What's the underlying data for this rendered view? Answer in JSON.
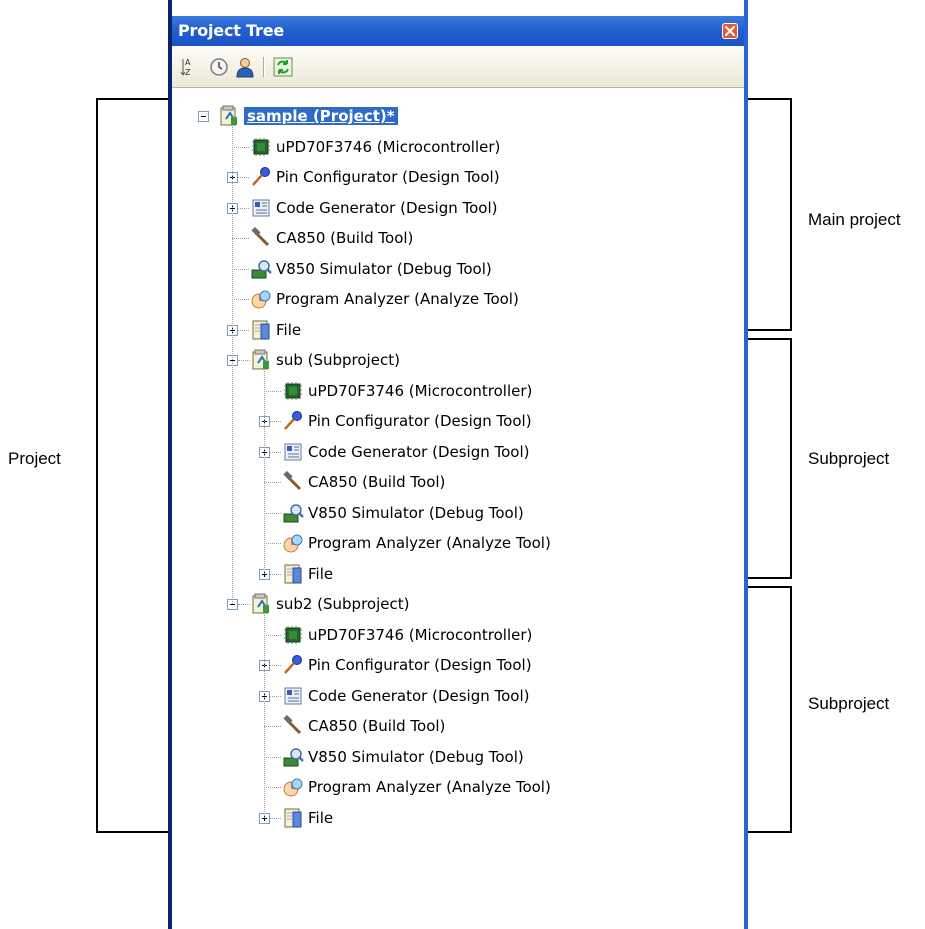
{
  "window": {
    "title": "Project Tree",
    "toolbar": {
      "buttons": [
        {
          "icon": "sort-az-icon"
        },
        {
          "icon": "clock-icon"
        },
        {
          "icon": "user-icon"
        },
        {
          "icon": "refresh-icon"
        }
      ]
    }
  },
  "tree": {
    "root": "sample (Project)*",
    "main_items": [
      {
        "label": "uPD70F3746 (Microcontroller)",
        "icon": "chip-icon"
      },
      {
        "label": "Pin Configurator (Design Tool)",
        "icon": "pin-icon"
      },
      {
        "label": "Code Generator (Design Tool)",
        "icon": "code-generator-icon"
      },
      {
        "label": "CA850 (Build Tool)",
        "icon": "hammer-icon"
      },
      {
        "label": "V850 Simulator (Debug Tool)",
        "icon": "debug-icon"
      },
      {
        "label": "Program Analyzer (Analyze Tool)",
        "icon": "analyzer-icon"
      },
      {
        "label": "File",
        "icon": "file-icon"
      }
    ],
    "subprojects": [
      {
        "label": "sub (Subproject)",
        "items": [
          {
            "label": "uPD70F3746 (Microcontroller)",
            "icon": "chip-icon"
          },
          {
            "label": "Pin Configurator (Design Tool)",
            "icon": "pin-icon"
          },
          {
            "label": "Code Generator (Design Tool)",
            "icon": "code-generator-icon"
          },
          {
            "label": "CA850 (Build Tool)",
            "icon": "hammer-icon"
          },
          {
            "label": "V850 Simulator (Debug Tool)",
            "icon": "debug-icon"
          },
          {
            "label": "Program Analyzer (Analyze Tool)",
            "icon": "analyzer-icon"
          },
          {
            "label": "File",
            "icon": "file-icon"
          }
        ]
      },
      {
        "label": "sub2 (Subproject)",
        "items": [
          {
            "label": "uPD70F3746 (Microcontroller)",
            "icon": "chip-icon"
          },
          {
            "label": "Pin Configurator (Design Tool)",
            "icon": "pin-icon"
          },
          {
            "label": "Code Generator (Design Tool)",
            "icon": "code-generator-icon"
          },
          {
            "label": "CA850 (Build Tool)",
            "icon": "hammer-icon"
          },
          {
            "label": "V850 Simulator (Debug Tool)",
            "icon": "debug-icon"
          },
          {
            "label": "Program Analyzer (Analyze Tool)",
            "icon": "analyzer-icon"
          },
          {
            "label": "File",
            "icon": "file-icon"
          }
        ]
      }
    ]
  },
  "annotations": {
    "project": "Project",
    "main_project": "Main project",
    "subproject_1": "Subproject",
    "subproject_2": "Subproject"
  },
  "colors": {
    "titlebar": "#2460d0",
    "selection": "#316ac5",
    "toolbar": "#ece9d8"
  }
}
